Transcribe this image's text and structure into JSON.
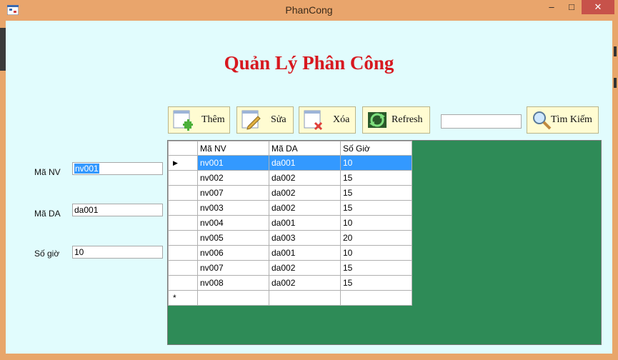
{
  "window": {
    "title": "PhanCong",
    "minimize": "–",
    "maximize": "□",
    "close": "✕"
  },
  "heading": "Quản Lý Phân Công",
  "form": {
    "ma_nv": {
      "label": "Mã NV",
      "value": "nv001"
    },
    "ma_da": {
      "label": "Mã DA",
      "value": "da001"
    },
    "so_gio": {
      "label": "Số giờ",
      "value": "10"
    }
  },
  "toolbar": {
    "add_label": "Thêm",
    "edit_label": "Sửa",
    "delete_label": "Xóa",
    "refresh_label": "Refresh",
    "search_label": "Tìm Kiếm",
    "search_value": ""
  },
  "grid": {
    "columns": [
      "Mã NV",
      "Mã DA",
      "Số Giờ"
    ],
    "rows": [
      [
        "nv001",
        "da001",
        "10"
      ],
      [
        "nv002",
        "da002",
        "15"
      ],
      [
        "nv007",
        "da002",
        "15"
      ],
      [
        "nv003",
        "da002",
        "15"
      ],
      [
        "nv004",
        "da001",
        "10"
      ],
      [
        "nv005",
        "da003",
        "20"
      ],
      [
        "nv006",
        "da001",
        "10"
      ],
      [
        "nv007",
        "da002",
        "15"
      ],
      [
        "nv008",
        "da002",
        "15"
      ]
    ],
    "selected_row": 0,
    "current_row_marker": "▶",
    "new_row_marker": "*"
  },
  "colors": {
    "titlebar": "#e9a56c",
    "client_bg": "#e1fcfd",
    "heading": "#d7181f",
    "grid_bg": "#2e8b57",
    "selection": "#3399ff",
    "button_bg": "#fffcd2"
  },
  "icons": {
    "add": "document-add-icon",
    "edit": "document-edit-icon",
    "delete": "document-delete-icon",
    "refresh": "refresh-icon",
    "search": "magnifier-icon"
  }
}
